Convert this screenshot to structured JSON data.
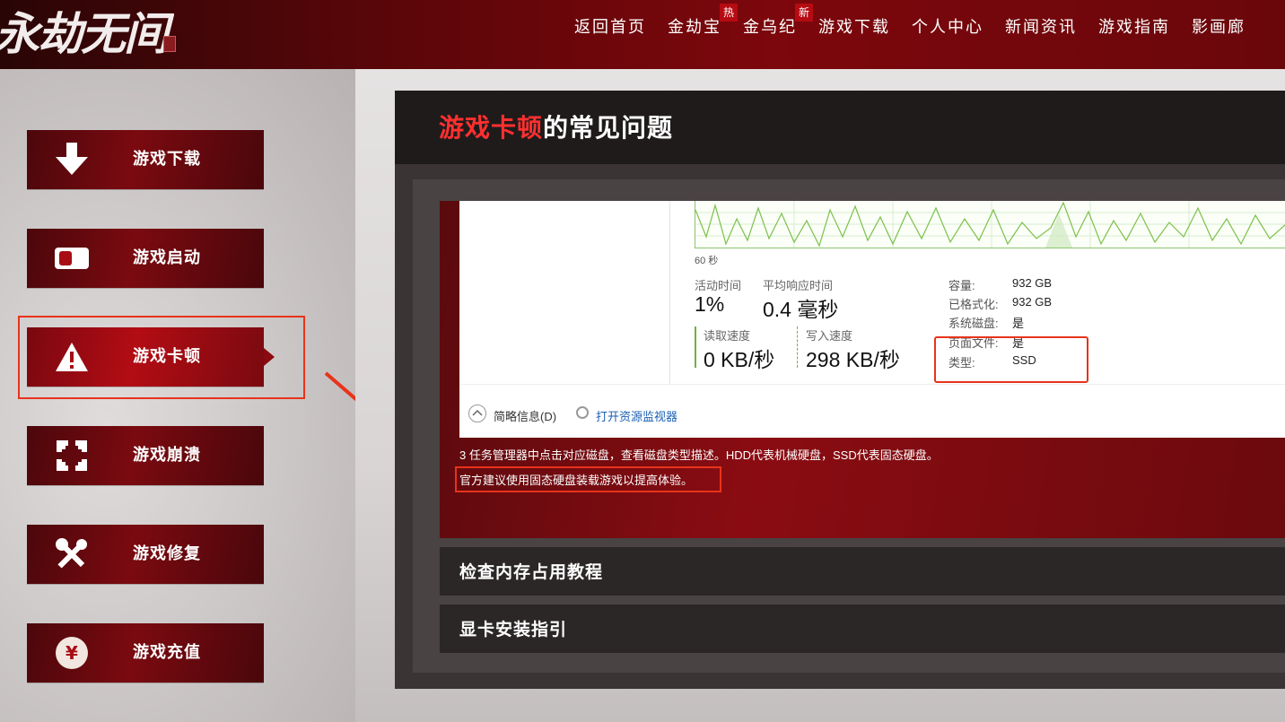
{
  "logo": {
    "text": "永劫无间"
  },
  "nav": {
    "items": [
      {
        "label": "返回首页",
        "badge": ""
      },
      {
        "label": "金劫宝",
        "badge": "热"
      },
      {
        "label": "金乌纪",
        "badge": "新"
      },
      {
        "label": "游戏下载",
        "badge": ""
      },
      {
        "label": "个人中心",
        "badge": ""
      },
      {
        "label": "新闻资讯",
        "badge": ""
      },
      {
        "label": "游戏指南",
        "badge": ""
      },
      {
        "label": "影画廊",
        "badge": ""
      }
    ]
  },
  "sidebar": {
    "items": [
      {
        "label": "游戏下载",
        "icon": "download-icon"
      },
      {
        "label": "游戏启动",
        "icon": "launch-icon"
      },
      {
        "label": "游戏卡顿",
        "icon": "warning-icon",
        "active": true
      },
      {
        "label": "游戏崩溃",
        "icon": "crash-icon"
      },
      {
        "label": "游戏修复",
        "icon": "repair-icon"
      },
      {
        "label": "游戏充值",
        "icon": "yen-icon"
      }
    ]
  },
  "main": {
    "title_highlight": "游戏卡顿",
    "title_rest": "的常见问题",
    "screenshot": {
      "graph_time": "60 秒",
      "active_time_label": "活动时间",
      "active_time_value": "1%",
      "response_label": "平均响应时间",
      "response_value": "0.4 毫秒",
      "read_label": "读取速度",
      "read_value": "0 KB/秒",
      "write_label": "写入速度",
      "write_value": "298 KB/秒",
      "props": [
        {
          "label": "容量:",
          "value": "932 GB"
        },
        {
          "label": "已格式化:",
          "value": "932 GB"
        },
        {
          "label": "系统磁盘:",
          "value": "是"
        },
        {
          "label": "页面文件:",
          "value": "是"
        },
        {
          "label": "类型:",
          "value": "SSD"
        }
      ],
      "summary_label": "简略信息(D)",
      "resource_monitor_link": "打开资源监视器"
    },
    "desc1": "3 任务管理器中点击对应磁盘，查看磁盘类型描述。HDD代表机械硬盘，SSD代表固态硬盘。",
    "desc2": "官方建议使用固态硬盘装载游戏以提高体验。",
    "accordions": [
      {
        "label": "检查内存占用教程"
      },
      {
        "label": "显卡安装指引"
      }
    ]
  },
  "colors": {
    "brand_red": "#7c070c",
    "accent_red": "#ff3030",
    "highlight_box": "#e8331b"
  }
}
